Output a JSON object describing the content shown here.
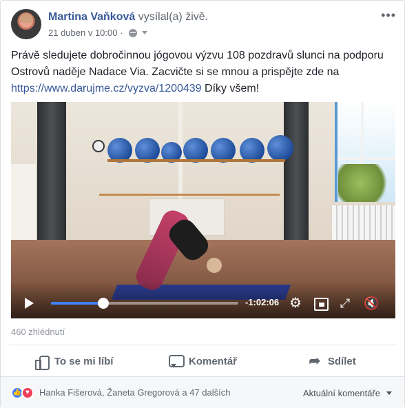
{
  "post": {
    "author": "Martina Vaňková",
    "action": "vysílal(a) živě.",
    "date": "21 duben v 10:00",
    "privacy_icon": "globe-icon",
    "text_before_link": "Právě sledujete dobročinnou jógovou výzvu 108 pozdravů slunci na podporu Ostrovů naděje Nadace Via. Zacvičte si se mnou a prispějte zde na ",
    "link": "https://www.darujme.cz/vyzva/1200439",
    "text_after_link": " Díky všem!"
  },
  "video": {
    "time_remaining": "-1:02:06",
    "progress": 0.28,
    "controls": [
      "play-icon",
      "gear-icon",
      "pip-icon",
      "fullscreen-icon",
      "mute-icon"
    ]
  },
  "stats": {
    "views": "460 zhlédnutí"
  },
  "actions": {
    "like": "To se mi líbí",
    "comment": "Komentář",
    "share": "Sdílet"
  },
  "footer": {
    "reactors": "Hanka Fišerová, Žaneta Gregorová a 47 dalších",
    "sort": "Aktuální komentáře"
  },
  "colors": {
    "link": "#365899",
    "progress": "#4080ff",
    "like_reaction": "#4080ff",
    "love_reaction": "#f33e58"
  }
}
